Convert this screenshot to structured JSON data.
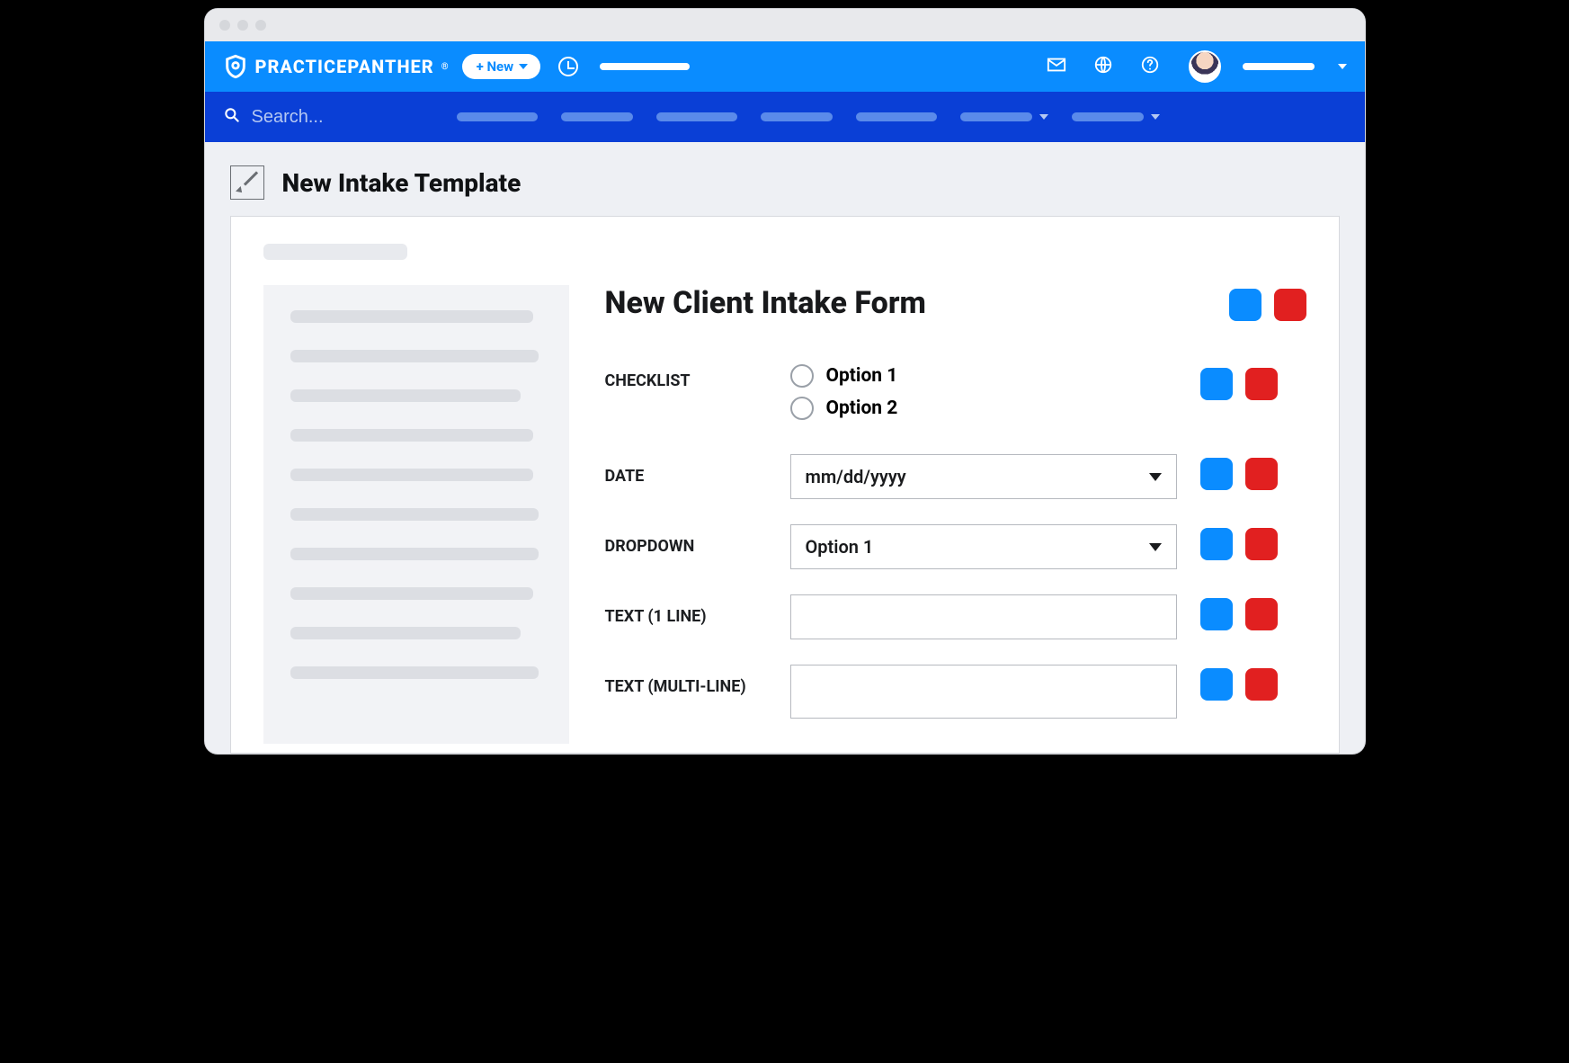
{
  "brand": "PRACTICEPANTHER",
  "new_button_label": "+ New",
  "search_placeholder": "Search...",
  "page_title": "New Intake Template",
  "form": {
    "title": "New Client Intake Form",
    "fields": {
      "checklist": {
        "label": "CHECKLIST",
        "option1": "Option 1",
        "option2": "Option 2"
      },
      "date": {
        "label": "DATE",
        "placeholder": "mm/dd/yyyy"
      },
      "dropdown": {
        "label": "DROPDOWN",
        "selected": "Option 1"
      },
      "text1": {
        "label": "TEXT (1 LINE)"
      },
      "textmulti": {
        "label": "TEXT (MULTI-LINE)"
      }
    }
  }
}
